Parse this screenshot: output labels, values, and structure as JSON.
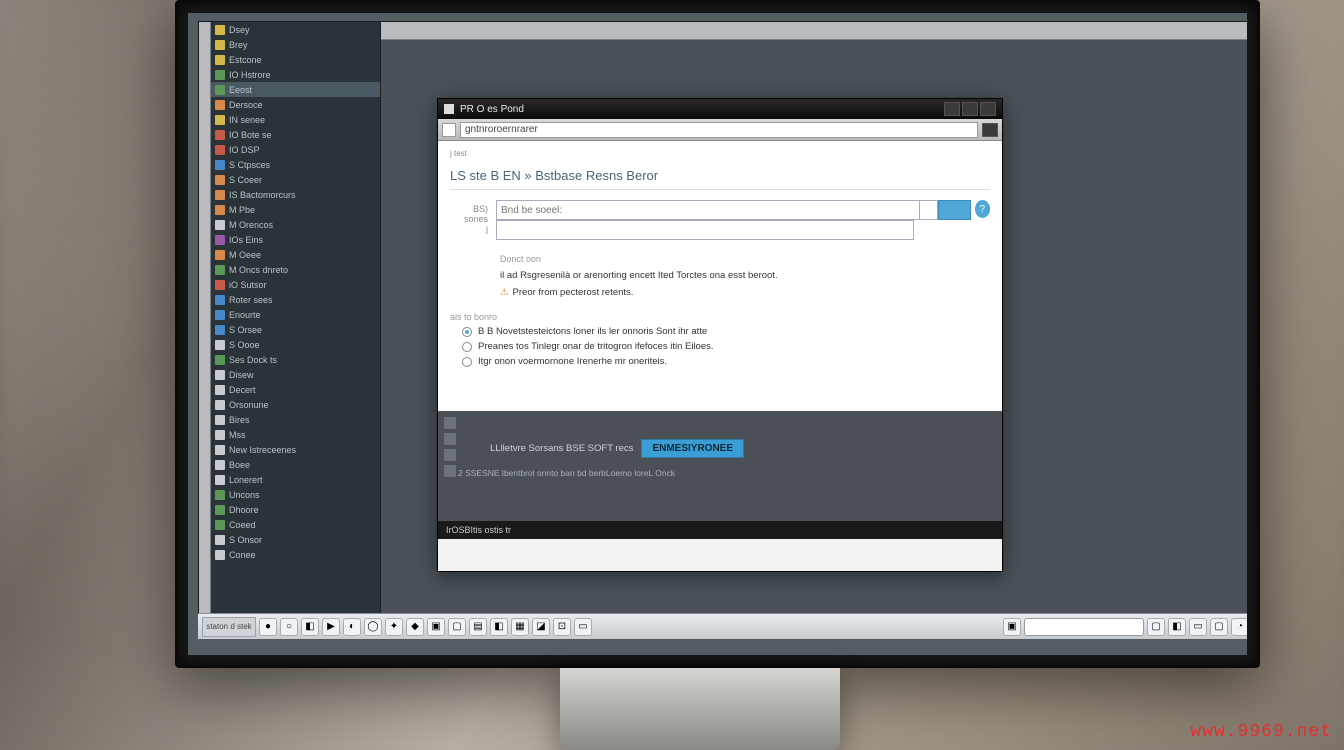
{
  "watermark": "www.9969.net",
  "sidebar": {
    "items": [
      {
        "label": "Dsey",
        "icon": "ic-y"
      },
      {
        "label": "Brey",
        "icon": "ic-y"
      },
      {
        "label": "Estcone",
        "icon": "ic-y"
      },
      {
        "label": "IO Hstrore",
        "icon": "ic-g"
      },
      {
        "label": "Eeost",
        "icon": "ic-g",
        "sel": true
      },
      {
        "label": "Dersoce",
        "icon": "ic-o"
      },
      {
        "label": "IN senee",
        "icon": "ic-y"
      },
      {
        "label": "IO Bote se",
        "icon": "ic-r"
      },
      {
        "label": "IO DSP",
        "icon": "ic-r"
      },
      {
        "label": "S Ctpsces",
        "icon": "ic-b"
      },
      {
        "label": "S Coeer",
        "icon": "ic-o"
      },
      {
        "label": "IS Bactomorcurs",
        "icon": "ic-o"
      },
      {
        "label": "M Pbe",
        "icon": "ic-o"
      },
      {
        "label": "M Orencos",
        "icon": "ic-w"
      },
      {
        "label": "IOs Eins",
        "icon": "ic-p"
      },
      {
        "label": "M Oeee",
        "icon": "ic-o"
      },
      {
        "label": "M Oncs dnreto",
        "icon": "ic-g"
      },
      {
        "label": "iO Sutsor",
        "icon": "ic-r"
      },
      {
        "label": "Roter sees",
        "icon": "ic-b"
      },
      {
        "label": "Enourte",
        "icon": "ic-b"
      },
      {
        "label": "S Orsee",
        "icon": "ic-b"
      },
      {
        "label": "S Oooe",
        "icon": "ic-w"
      },
      {
        "label": "Ses Dock ts",
        "icon": "ic-g"
      },
      {
        "label": "Disew",
        "icon": "ic-w"
      },
      {
        "label": "Decert",
        "icon": "ic-w"
      },
      {
        "label": "Orsonune",
        "icon": "ic-w"
      },
      {
        "label": "Bires",
        "icon": "ic-w"
      },
      {
        "label": "Mss",
        "icon": "ic-w"
      },
      {
        "label": "New Istreceenes",
        "icon": "ic-w"
      },
      {
        "label": "Boee",
        "icon": "ic-w"
      },
      {
        "label": "Lonerert",
        "icon": "ic-w"
      },
      {
        "label": "Uncons",
        "icon": "ic-g"
      },
      {
        "label": "Dhoore",
        "icon": "ic-g"
      },
      {
        "label": "Coeed",
        "icon": "ic-g"
      },
      {
        "label": "S Onsor",
        "icon": "ic-w"
      },
      {
        "label": "Conee",
        "icon": "ic-w"
      }
    ]
  },
  "dialog": {
    "title": "PR O es   Pond",
    "url_text": "gntnroroernrarer",
    "crumb": "j test",
    "heading": "LS ste B  EN » Bstbase Resns Beror",
    "form_labels": {
      "first": "BS)",
      "second": "sones",
      "third": "j"
    },
    "input_label": "Bnd be soeel:",
    "desc_label": "Donct oon",
    "para1": "il ad Rsgresenilà or arenorting encett Ited Torctes ona esst beroot.",
    "para2": "Preor from pecterost retents.",
    "section2": "als to    bonro",
    "radio1": "B B Novetstesteictons loner ils ler onnoris Sont ihr atte",
    "radio2": "Preanes tos Tinlegr onar de tritogron ifefoces itin Eiloes.",
    "radio3": "Itgr onon voermornone Irenerhe mr oneriteis.",
    "dark_line": "LLlletvre Sorsans BSE SOFT recs",
    "dark_btn": "ENMESIYRONEE",
    "dark_foot": "2 SSESNE lbentbrol onnto ban bd berbLoemo loreL Onck",
    "status": "IrOSBItis ostis tr"
  },
  "taskbar": {
    "start": "staton d stek",
    "icons": [
      "●",
      "○",
      "◧",
      "▶",
      "◐",
      "◯",
      "✦",
      "◆",
      "▣",
      "▢",
      "▤",
      "◧",
      "▦",
      "◪",
      "⊡",
      "▭"
    ],
    "tray": [
      "▢",
      "◧",
      "▭",
      "▢",
      "◔"
    ]
  }
}
